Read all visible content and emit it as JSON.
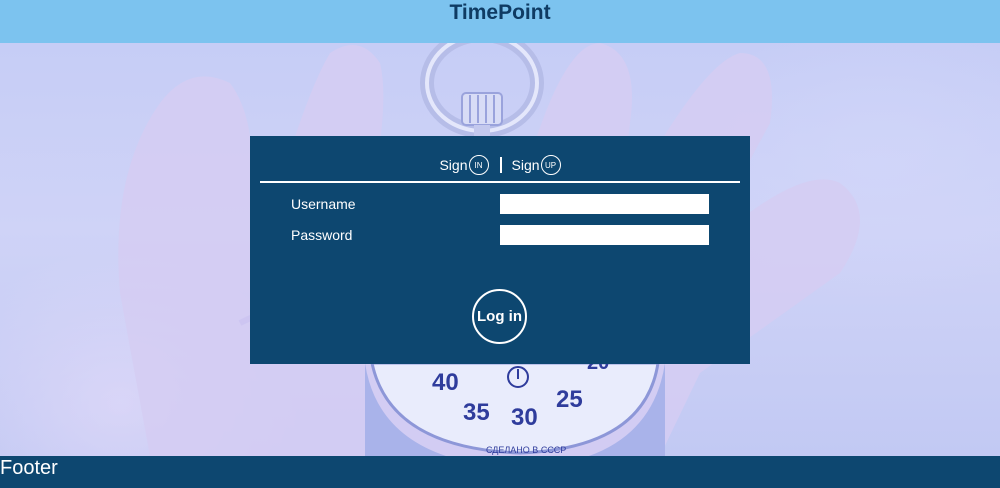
{
  "header": {
    "title": "TimePoint"
  },
  "login": {
    "tab_signin_label": "Sign",
    "tab_signin_badge": "IN",
    "tab_signup_label": "Sign",
    "tab_signup_badge": "UP",
    "username_label": "Username",
    "username_value": "",
    "password_label": "Password",
    "password_value": "",
    "login_button": "Log in"
  },
  "background": {
    "dial_numbers": [
      "40",
      "35",
      "30",
      "25",
      "20"
    ],
    "dial_caption": "СДЕЛАНО В СССР"
  },
  "footer": {
    "text": "Footer"
  },
  "colors": {
    "header_bg": "#7cc3ef",
    "title_color": "#0f3b63",
    "panel_bg": "#0d4770",
    "footer_bg": "#0d4770"
  }
}
